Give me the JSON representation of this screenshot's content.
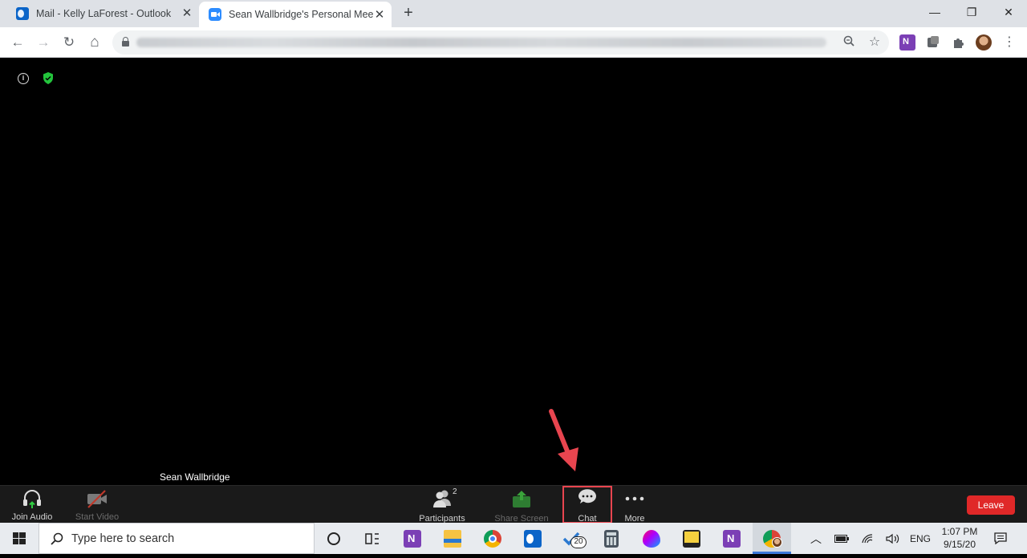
{
  "browser": {
    "tabs": [
      {
        "title": "Mail - Kelly LaForest - Outlook",
        "active": false
      },
      {
        "title": "Sean Wallbridge's Personal Meeti",
        "active": true
      }
    ],
    "close_glyph": "✕",
    "new_tab_glyph": "+",
    "window_controls": {
      "minimize": "—",
      "restore": "❐",
      "close": "✕"
    },
    "nav": {
      "back": "←",
      "forward": "→",
      "reload": "↻",
      "home": "⌂"
    },
    "url_blurred": true
  },
  "meeting": {
    "speaker_name": "Sean Wallbridge",
    "info_icon": "i"
  },
  "controls": {
    "join_audio": "Join Audio",
    "start_video": "Start Video",
    "participants": "Participants",
    "participants_count": "2",
    "share_screen": "Share Screen",
    "chat": "Chat",
    "more": "More",
    "leave": "Leave"
  },
  "taskbar": {
    "search_placeholder": "Type here to search",
    "badge_count": "20",
    "language": "ENG",
    "time": "1:07 PM",
    "date": "9/15/20"
  },
  "colors": {
    "leave_red": "#e02828",
    "annotation_red": "#e8454f",
    "share_green": "#3aa33a",
    "chrome_tab_bg": "#dee1e6"
  }
}
